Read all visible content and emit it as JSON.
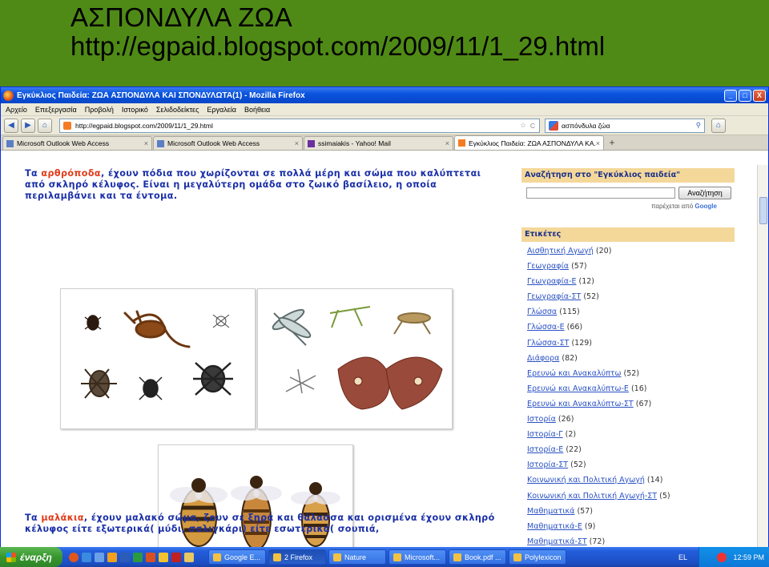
{
  "slide": {
    "title": "ΑΣΠΟΝΔΥΛΑ ΖΩΑ",
    "url": "http://egpaid.blogspot.com/2009/11/1_29.html"
  },
  "window": {
    "title": "Εγκύκλιος Παιδεία: ΖΩΑ ΑΣΠΟΝΔΥΛΑ ΚΑΙ ΣΠΟΝΔΥΛΩΤΑ(1) - Mozilla Firefox",
    "minimize": "_",
    "maximize": "□",
    "close": "X"
  },
  "menu": [
    "Αρχείο",
    "Επεξεργασία",
    "Προβολή",
    "Ιστορικό",
    "Σελιδοδείκτες",
    "Εργαλεία",
    "Βοήθεια"
  ],
  "nav": {
    "back": "◀",
    "forward": "▶",
    "home": "⌂",
    "url": "http://egpaid.blogspot.com/2009/11/1_29.html",
    "star": "☆",
    "reload": "C",
    "search_value": "ασπόνδυλα ζώα",
    "search_icon": "⚲",
    "home_icon": "⌂"
  },
  "tabs": [
    {
      "label": "Microsoft Outlook Web Access",
      "active": false
    },
    {
      "label": "Microsoft Outlook Web Access",
      "active": false
    },
    {
      "label": "ssimaiakis - Yahoo! Mail",
      "active": false
    },
    {
      "label": "Εγκύκλιος Παιδεία: ΖΩΑ ΑΣΠΟΝΔΥΛΑ ΚΑ...",
      "active": true
    }
  ],
  "tab_close": "×",
  "tab_new": "+",
  "content": {
    "para1_pre": "Τα ",
    "para1_hl": "αρθρόποδα",
    "para1_post": ", έχουν πόδια που χωρίζονται σε πολλά μέρη και σώμα που καλύπτεται από σκληρό κέλυφος. Είναι η μεγαλύτερη ομάδα στο ζωικό βασίλειο, η οποία περιλαμβάνει και τα έντομα.",
    "para2_pre": "Τα ",
    "para2_hl": "μαλάκια",
    "para2_post": ", έχουν μαλακό σώμα, ζουν σε ξηρά και θάλασσα και ορισμένα έχουν σκληρό κέλυφος είτε εξωτερικά( μύδι, σαλιγκάρι) είτε εσωτερικά( σουπιά,"
  },
  "sidebar": {
    "search_heading": "Αναζήτηση στο \"Εγκύκλιος παιδεία\"",
    "search_button": "Αναζήτηση",
    "powered_by": "παρέχεται από",
    "google": "Google",
    "labels_heading": "Ετικέτες",
    "labels": [
      {
        "name": "Αισθητική Αγωγή",
        "count": "(20)"
      },
      {
        "name": "Γεωγραφία",
        "count": "(57)"
      },
      {
        "name": "Γεωγραφία-Ε",
        "count": "(12)"
      },
      {
        "name": "Γεωγραφία-ΣΤ",
        "count": "(52)"
      },
      {
        "name": "Γλώσσα",
        "count": "(115)"
      },
      {
        "name": "Γλώσσα-Ε",
        "count": "(66)"
      },
      {
        "name": "Γλώσσα-ΣΤ",
        "count": "(129)"
      },
      {
        "name": "Διάφορα",
        "count": "(82)"
      },
      {
        "name": "Ερευνώ και Ανακαλύπτω",
        "count": "(52)"
      },
      {
        "name": "Ερευνώ και Ανακαλύπτω-Ε",
        "count": "(16)"
      },
      {
        "name": "Ερευνώ και Ανακαλύπτω-ΣΤ",
        "count": "(67)"
      },
      {
        "name": "Ιστορία",
        "count": "(26)"
      },
      {
        "name": "Ιστορία-Γ",
        "count": "(2)"
      },
      {
        "name": "Ιστορία-Ε",
        "count": "(22)"
      },
      {
        "name": "Ιστορία-ΣΤ",
        "count": "(52)"
      },
      {
        "name": "Κοινωνική και Πολιτική Αγωγή",
        "count": "(14)"
      },
      {
        "name": "Κοινωνική και Πολιτική Αγωγή-ΣΤ",
        "count": "(5)"
      },
      {
        "name": "Μαθηματικά",
        "count": "(57)"
      },
      {
        "name": "Μαθηματικά-Ε",
        "count": "(9)"
      },
      {
        "name": "Μαθηματικά-ΣΤ",
        "count": "(72)"
      }
    ]
  },
  "taskbar": {
    "start": "έναρξη",
    "buttons": [
      {
        "label": "Google E...",
        "active": false
      },
      {
        "label": "2 Firefox",
        "active": true
      },
      {
        "label": "Nature",
        "active": false
      },
      {
        "label": "Microsoft...",
        "active": false
      },
      {
        "label": "Book.pdf ...",
        "active": false
      },
      {
        "label": "Polylexicon",
        "active": false
      }
    ],
    "lang": "EL",
    "clock": "12:59 PM"
  },
  "colors": {
    "slide_bg": "#4f8a16",
    "para_text": "#1a2fa8",
    "highlight": "#e23b1a",
    "sidebar_header": "#f4d89a",
    "link": "#2a51c4"
  }
}
